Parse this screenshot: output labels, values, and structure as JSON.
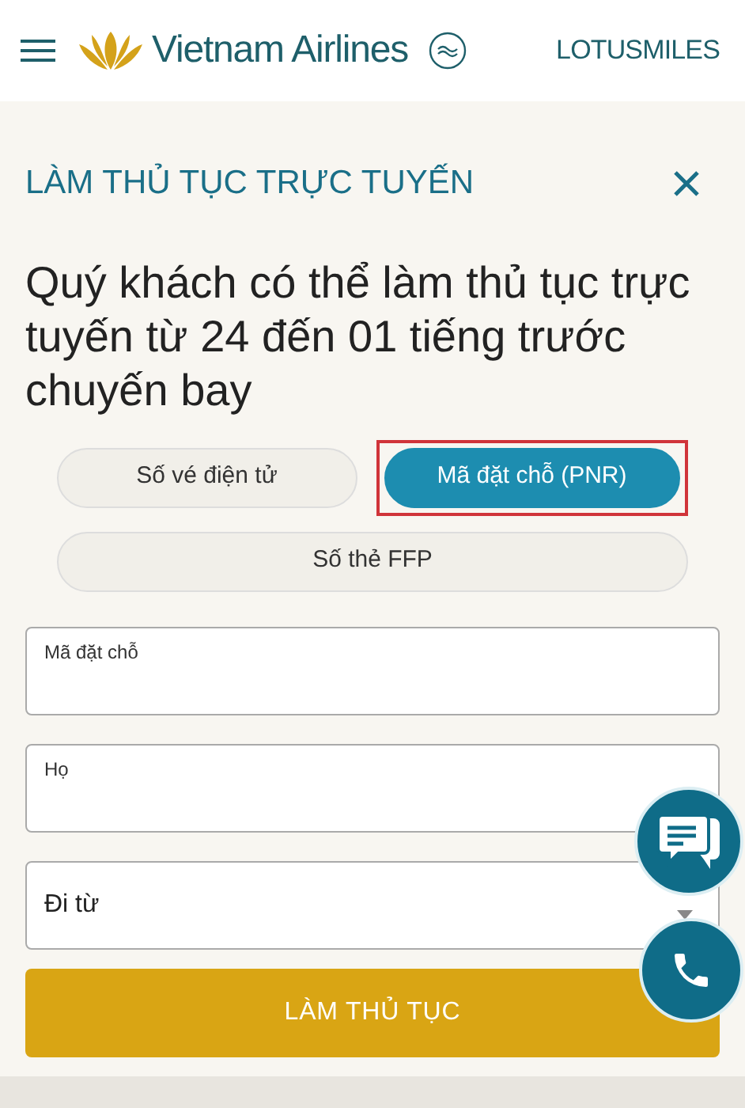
{
  "header": {
    "brand": "Vietnam Airlines",
    "loyalty": "LOTUSMILES"
  },
  "panel": {
    "title": "LÀM THỦ TỤC TRỰC TUYẾN",
    "heading": "Quý khách có thể làm thủ tục trực tuyến từ 24 đến 01 tiếng trước chuyến bay"
  },
  "options": [
    {
      "label": "Số vé điện tử",
      "selected": false,
      "highlighted": false
    },
    {
      "label": "Mã đặt chỗ (PNR)",
      "selected": true,
      "highlighted": true
    },
    {
      "label": "Số thẻ FFP",
      "selected": false,
      "highlighted": false
    }
  ],
  "fields": [
    {
      "kind": "text",
      "label": "Mã đặt chỗ"
    },
    {
      "kind": "text",
      "label": "Họ"
    },
    {
      "kind": "select",
      "label": "Đi từ"
    }
  ],
  "submit": "LÀM THỦ TỤC"
}
